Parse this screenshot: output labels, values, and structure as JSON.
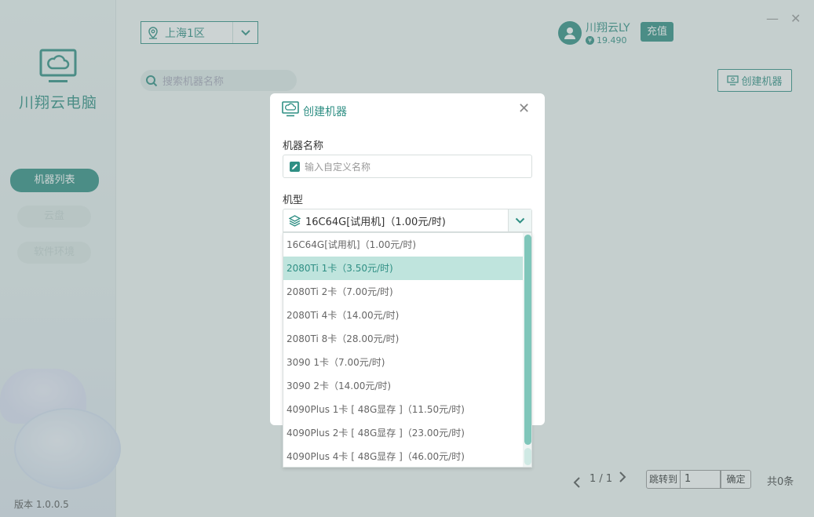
{
  "app": {
    "name": "川翔云电脑",
    "version": "版本 1.0.0.5",
    "nav": [
      {
        "label": "机器列表",
        "active": true
      },
      {
        "label": "云盘",
        "active": false
      },
      {
        "label": "软件环境",
        "active": false
      }
    ]
  },
  "header": {
    "region": "上海1区",
    "search_placeholder": "搜索机器名称",
    "username": "川翔云LY",
    "balance": "19.490",
    "coin_symbol": "¥",
    "recharge_label": "充值",
    "create_label": "创建机器",
    "minimize": "—",
    "close": "✕"
  },
  "pagination": {
    "page": "1 / 1",
    "jump_label": "跳转到",
    "jump_value": "1",
    "confirm_label": "确定",
    "total": "共0条"
  },
  "modal": {
    "title": "创建机器",
    "close": "✕",
    "name_label": "机器名称",
    "name_placeholder": "输入自定义名称",
    "type_label": "机型",
    "selected_type": "16C64G[试用机]（1.00元/时)",
    "options": [
      {
        "label": "16C64G[试用机]（1.00元/时)",
        "highlighted": false
      },
      {
        "label": "2080Ti 1卡（3.50元/时)",
        "highlighted": true
      },
      {
        "label": "2080Ti 2卡（7.00元/时)",
        "highlighted": false
      },
      {
        "label": "2080Ti 4卡（14.00元/时)",
        "highlighted": false
      },
      {
        "label": "2080Ti 8卡（28.00元/时)",
        "highlighted": false
      },
      {
        "label": "3090 1卡（7.00元/时)",
        "highlighted": false
      },
      {
        "label": "3090 2卡（14.00元/时)",
        "highlighted": false
      },
      {
        "label": "4090Plus 1卡 [ 48G显存 ]（11.50元/时)",
        "highlighted": false
      },
      {
        "label": "4090Plus 2卡 [ 48G显存 ]（23.00元/时)",
        "highlighted": false
      },
      {
        "label": "4090Plus 4卡 [ 48G显存 ]（46.00元/时)",
        "highlighted": false
      }
    ]
  },
  "colors": {
    "accent": "#2f8f84",
    "highlight": "#bfe4dd"
  }
}
